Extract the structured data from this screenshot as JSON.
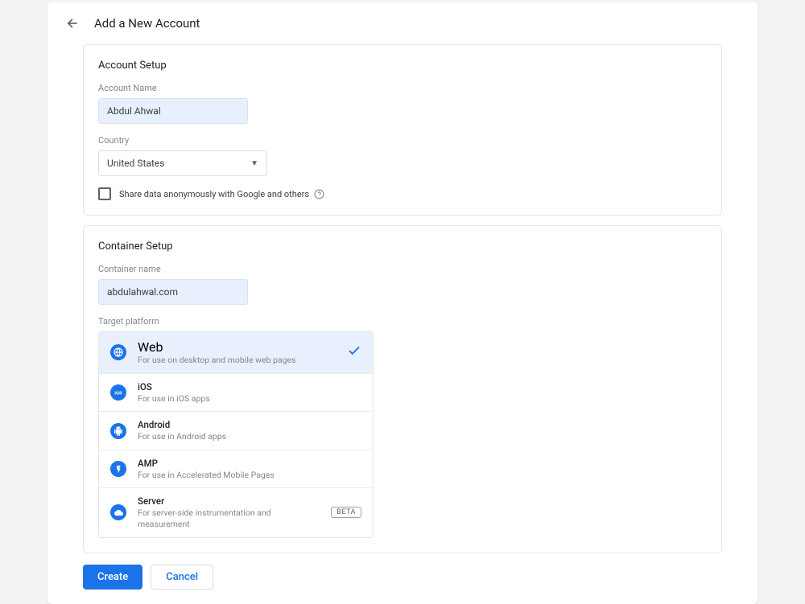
{
  "header": {
    "title": "Add a New Account"
  },
  "account_setup": {
    "title": "Account Setup",
    "account_name_label": "Account Name",
    "account_name_value": "Abdul Ahwal",
    "country_label": "Country",
    "country_value": "United States",
    "share_data_label": "Share data anonymously with Google and others"
  },
  "container_setup": {
    "title": "Container Setup",
    "container_name_label": "Container name",
    "container_name_value": "abdulahwal.com",
    "target_platform_label": "Target platform",
    "platforms": [
      {
        "name": "Web",
        "desc": "For use on desktop and mobile web pages"
      },
      {
        "name": "iOS",
        "desc": "For use in iOS apps"
      },
      {
        "name": "Android",
        "desc": "For use in Android apps"
      },
      {
        "name": "AMP",
        "desc": "For use in Accelerated Mobile Pages"
      },
      {
        "name": "Server",
        "desc": "For server-side instrumentation and measurement",
        "badge": "BETA"
      }
    ]
  },
  "buttons": {
    "create": "Create",
    "cancel": "Cancel"
  }
}
